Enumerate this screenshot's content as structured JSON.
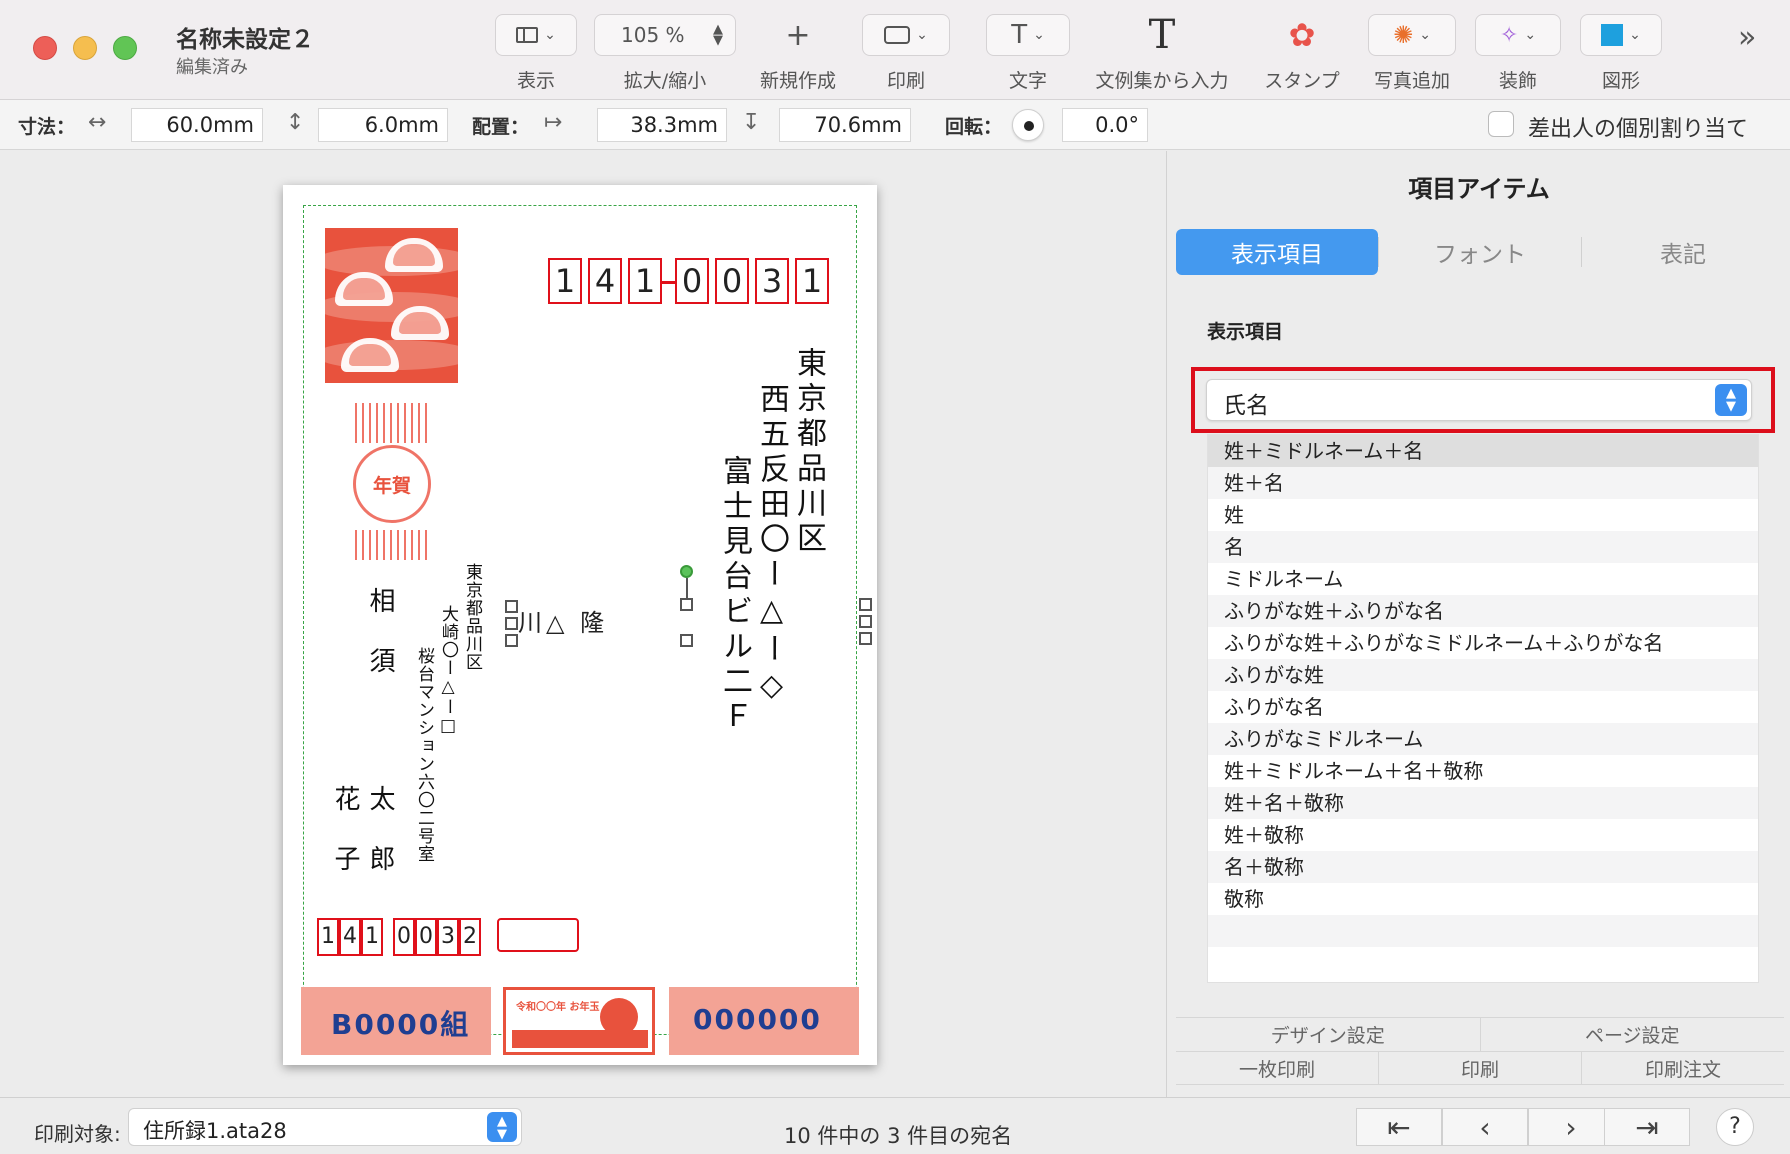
{
  "window": {
    "title": "名称未設定２",
    "subtitle": "編集済み"
  },
  "toolbar": {
    "view_label": "表示",
    "zoom_value": "105 %",
    "zoom_label": "拡大/縮小",
    "new_label": "新規作成",
    "print_label": "印刷",
    "text_label": "文字",
    "template_text_label": "文例集から入力",
    "stamp_label": "スタンプ",
    "photo_label": "写真追加",
    "decoration_label": "装飾",
    "shape_label": "図形"
  },
  "propbar": {
    "size_label": "寸法：",
    "width": "60.0mm",
    "height": "6.0mm",
    "position_label": "配置：",
    "x": "38.3mm",
    "y": "70.6mm",
    "rotation_label": "回転：",
    "rotation": "0.0°",
    "individual_sender_label": "差出人の個別割り当て"
  },
  "card": {
    "recipient_zip": [
      "1",
      "4",
      "1",
      "0",
      "0",
      "3",
      "1"
    ],
    "recipient_address_col1": "東京都品川区",
    "recipient_address_col2": "西五反田〇ー△ー◇",
    "recipient_address_col3": "富士見台ビル二Ｆ",
    "recipient_name_preview": "川△ 隆",
    "sender_name_col1": "相須",
    "sender_name_col2a": "太郎",
    "sender_name_col2b": "花子",
    "sender_address_col1": "東京都品川区",
    "sender_address_col2": "大崎〇ー△ー□",
    "sender_address_col3": "桜台マンション六〇二号室",
    "sender_zip": [
      "1",
      "4",
      "1",
      "0",
      "0",
      "3",
      "2"
    ],
    "lottery_group": "B0000組",
    "lottery_number": "000000",
    "nenga_mark": "年賀",
    "otoshidama": "令和〇〇年 お年玉"
  },
  "panel": {
    "title": "項目アイテム",
    "tabs": [
      "表示項目",
      "フォント",
      "表記"
    ],
    "section_label": "表示項目",
    "selected_field": "氏名",
    "options": [
      "姓＋ミドルネーム＋名",
      "姓＋名",
      "姓",
      "名",
      "ミドルネーム",
      "ふりがな姓＋ふりがな名",
      "ふりがな姓＋ふりがなミドルネーム＋ふりがな名",
      "ふりがな姓",
      "ふりがな名",
      "ふりがなミドルネーム",
      "姓＋ミドルネーム＋名＋敬称",
      "姓＋名＋敬称",
      "姓＋敬称",
      "名＋敬称",
      "敬称",
      "",
      ""
    ],
    "bottom_buttons_row1": [
      "デザイン設定",
      "ページ設定"
    ],
    "bottom_buttons_row2": [
      "一枚印刷",
      "印刷",
      "印刷注文"
    ]
  },
  "statusbar": {
    "print_target_label": "印刷対象:",
    "print_target_value": "住所録1.ata28",
    "record_status": "10 件中の 3 件目の宛名"
  },
  "colors": {
    "accent": "#4499ef",
    "highlight_red": "#dc0e1b",
    "zip_red": "#e0101a",
    "guide_green": "#37a445",
    "lottery_blue": "#1f3e91"
  }
}
